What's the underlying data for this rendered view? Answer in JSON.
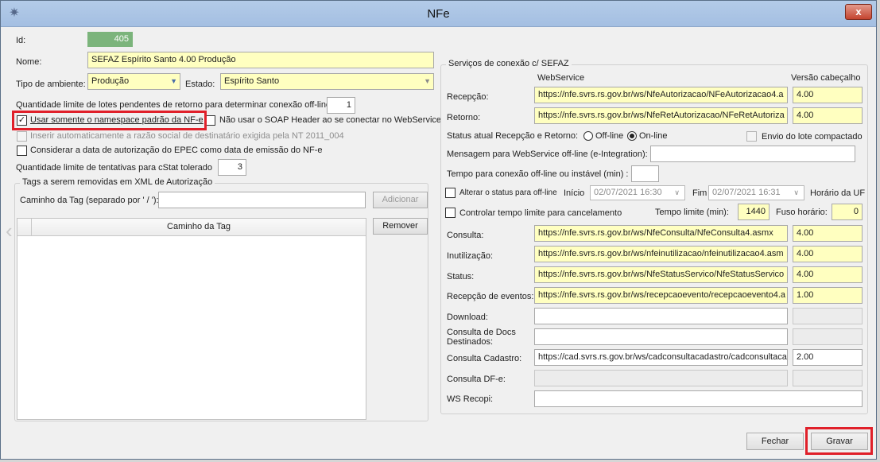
{
  "window": {
    "title": "NFe",
    "close_label": "x"
  },
  "left": {
    "id_label": "Id:",
    "id_value": "405",
    "nome_label": "Nome:",
    "nome_value": "SEFAZ Espírito Santo 4.00 Produção",
    "tipo_ambiente_label": "Tipo de ambiente:",
    "tipo_ambiente_value": "Produção",
    "estado_label": "Estado:",
    "estado_value": "Espírito Santo",
    "qtd_lotes_label": "Quantidade limite de lotes pendentes de retorno para determinar conexão off-line:",
    "qtd_lotes_value": "1",
    "usar_namespace_label": "Usar somente o namespace padrão da NF-e",
    "usar_namespace_checked": true,
    "nao_soap_label": "Não usar o SOAP Header ao se conectar no WebService",
    "nao_soap_checked": false,
    "inserir_razao_label": "Inserir automaticamente a razão social de destinatário exigida pela NT 2011_004",
    "inserir_razao_checked": false,
    "considerar_epec_label": "Considerar a data de autorização do EPEC como data de emissão do NF-e",
    "considerar_epec_checked": false,
    "qtd_tentativas_label": "Quantidade limite de tentativas para cStat tolerado",
    "qtd_tentativas_value": "3",
    "tags_group_label": "Tags a serem removidas em XML de Autorização",
    "caminho_tag_label": "Caminho da Tag (separado por ' / '):",
    "caminho_tag_value": "",
    "adicionar_label": "Adicionar",
    "remover_label": "Remover",
    "grid_header": "Caminho da Tag"
  },
  "services": {
    "group_label": "Serviços de conexão c/ SEFAZ",
    "col_webservice": "WebService",
    "col_versao": "Versão cabeçalho",
    "recepcao_label": "Recepção:",
    "recepcao_url": "https://nfe.svrs.rs.gov.br/ws/NfeAutorizacao/NFeAutorizacao4.a",
    "recepcao_versao": "4.00",
    "retorno_label": "Retorno:",
    "retorno_url": "https://nfe.svrs.rs.gov.br/ws/NfeRetAutorizacao/NFeRetAutoriza",
    "retorno_versao": "4.00",
    "status_atual_label": "Status atual Recepção e Retorno:",
    "offline_label": "Off-line",
    "online_label": "On-line",
    "online_selected": true,
    "envio_lote_label": "Envio do lote compactado",
    "envio_lote_checked": false,
    "mensagem_label": "Mensagem para WebService off-line (e-Integration):",
    "mensagem_value": "",
    "tempo_conexao_label": "Tempo para conexão off-line ou instável (min) :",
    "tempo_conexao_value": "",
    "alterar_status_label": "Alterar o status para off-line",
    "alterar_status_checked": false,
    "inicio_label": "Início",
    "inicio_value": "02/07/2021 16:30",
    "fim_label": "Fim",
    "fim_value": "02/07/2021 16:31",
    "horario_uf_label": "Horário da UF",
    "controlar_label": "Controlar tempo limite para cancelamento",
    "controlar_checked": false,
    "tempo_limite_label": "Tempo limite (min):",
    "tempo_limite_value": "1440",
    "fuso_label": "Fuso horário:",
    "fuso_value": "0",
    "consulta_label": "Consulta:",
    "consulta_url": "https://nfe.svrs.rs.gov.br/ws/NfeConsulta/NfeConsulta4.asmx",
    "consulta_versao": "4.00",
    "inutilizacao_label": "Inutilização:",
    "inutilizacao_url": "https://nfe.svrs.rs.gov.br/ws/nfeinutilizacao/nfeinutilizacao4.asm",
    "inutilizacao_versao": "4.00",
    "status_label": "Status:",
    "status_url": "https://nfe.svrs.rs.gov.br/ws/NfeStatusServico/NfeStatusServico",
    "status_versao": "4.00",
    "eventos_label": "Recepção de eventos:",
    "eventos_url": "https://nfe.svrs.rs.gov.br/ws/recepcaoevento/recepcaoevento4.a",
    "eventos_versao": "1.00",
    "download_label": "Download:",
    "consulta_docs_label_1": "Consulta de Docs",
    "consulta_docs_label_2": "Destinados:",
    "consulta_cadastro_label": "Consulta Cadastro:",
    "consulta_cadastro_url": "https://cad.svrs.rs.gov.br/ws/cadconsultacadastro/cadconsultaca",
    "consulta_cadastro_versao": "2.00",
    "consulta_dfe_label": "Consulta DF-e:",
    "ws_recopi_label": "WS Recopi:"
  },
  "footer": {
    "fechar_label": "Fechar",
    "gravar_label": "Gravar"
  },
  "colors": {
    "required_field": "#ffffc0",
    "highlight_box": "#e0202a",
    "id_field": "#7bb47b"
  }
}
